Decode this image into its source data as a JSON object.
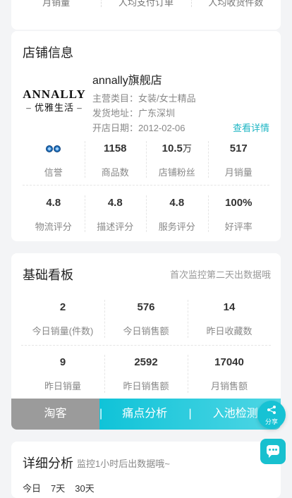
{
  "top_card": {
    "labels": [
      "月销量",
      "人均支付订单",
      "人均收货件数"
    ]
  },
  "shop": {
    "section_title": "店铺信息",
    "logo_en": "ANNALLY",
    "logo_cn": "– 优雅生活 –",
    "name": "annally旗舰店",
    "category": "主营类目：女装/女士精品",
    "address": "发货地址：广东深圳",
    "open_date": "开店日期：2012-02-06",
    "detail_link": "查看详情",
    "stats_row1": [
      {
        "value": "",
        "label": "信誉",
        "icon": "crown-badge-icon"
      },
      {
        "value": "1158",
        "label": "商品数"
      },
      {
        "value": "10.5",
        "unit": "万",
        "label": "店铺粉丝"
      },
      {
        "value": "517",
        "label": "月销量"
      }
    ],
    "stats_row2": [
      {
        "value": "4.8",
        "label": "物流评分"
      },
      {
        "value": "4.8",
        "label": "描述评分"
      },
      {
        "value": "4.8",
        "label": "服务评分"
      },
      {
        "value": "100%",
        "label": "好评率"
      }
    ]
  },
  "board": {
    "section_title": "基础看板",
    "hint": "首次监控第二天出数据哦",
    "row1": [
      {
        "value": "2",
        "label": "今日销量(件数)"
      },
      {
        "value": "576",
        "label": "今日销售额"
      },
      {
        "value": "14",
        "label": "昨日收藏数"
      }
    ],
    "row2": [
      {
        "value": "9",
        "label": "昨日销量"
      },
      {
        "value": "2592",
        "label": "昨日销售额"
      },
      {
        "value": "17040",
        "label": "月销售额"
      }
    ],
    "tabs": [
      "淘客",
      "痛点分析",
      "入池检测"
    ]
  },
  "share": {
    "label": "分享",
    "icon": "share-icon"
  },
  "detail": {
    "section_title": "详细分析",
    "hint": "监控1小时后出数据哦~",
    "periods": [
      "今日",
      "7天",
      "30天"
    ]
  },
  "chat": {
    "icon": "chat-icon"
  },
  "colors": {
    "accent": "#1fb6c4",
    "tab_gray": "#9b9b9b"
  }
}
